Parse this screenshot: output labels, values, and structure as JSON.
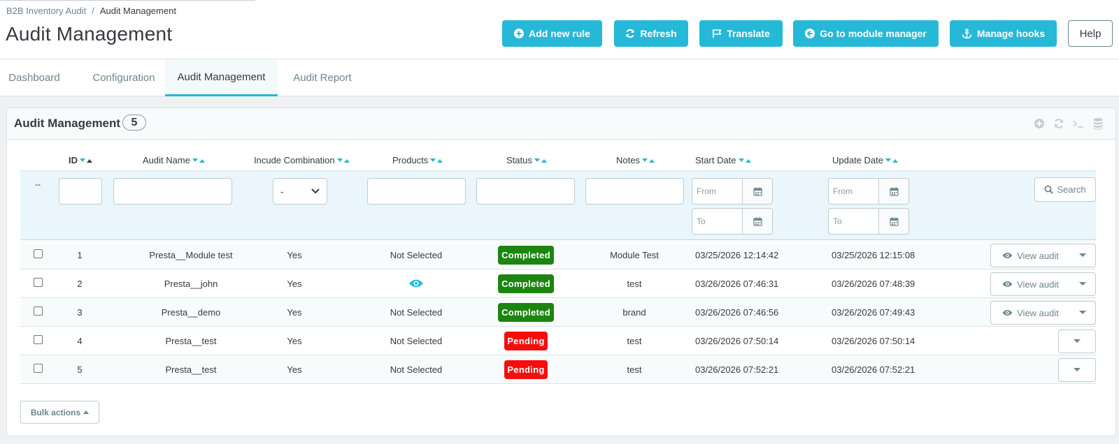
{
  "breadcrumb": {
    "parent": "B2B Inventory Audit",
    "separator": "/",
    "current": "Audit Management"
  },
  "page_title": "Audit Management",
  "toolbar": {
    "add_rule": "Add new rule",
    "refresh": "Refresh",
    "translate": "Translate",
    "module_manager": "Go to module manager",
    "manage_hooks": "Manage hooks",
    "help": "Help"
  },
  "tabs": [
    {
      "label": "Dashboard"
    },
    {
      "label": "Configuration"
    },
    {
      "label": "Audit Management",
      "active": true
    },
    {
      "label": "Audit Report"
    }
  ],
  "panel": {
    "title": "Audit Management",
    "count": "5"
  },
  "columns": {
    "id": "ID",
    "name": "Audit Name",
    "combination": "Incude Combination",
    "products": "Products",
    "status": "Status",
    "notes": "Notes",
    "start_date": "Start Date",
    "update_date": "Update Date"
  },
  "filters": {
    "dash": "--",
    "select_value": "-",
    "from_placeholder": "From",
    "to_placeholder": "To",
    "search_label": "Search"
  },
  "rows": [
    {
      "id": "1",
      "name": "Presta__Module test",
      "combination": "Yes",
      "products": "Not Selected",
      "status": "Completed",
      "notes": "Module Test",
      "start": "03/25/2026 12:14:42",
      "updated": "03/25/2026 12:15:08",
      "action": "View audit"
    },
    {
      "id": "2",
      "name": "Presta__john",
      "combination": "Yes",
      "products": "",
      "status": "Completed",
      "notes": "test",
      "start": "03/26/2026 07:46:31",
      "updated": "03/26/2026 07:48:39",
      "action": "View audit"
    },
    {
      "id": "3",
      "name": "Presta__demo",
      "combination": "Yes",
      "products": "Not Selected",
      "status": "Completed",
      "notes": "brand",
      "start": "03/26/2026 07:46:56",
      "updated": "03/26/2026 07:49:43",
      "action": "View audit"
    },
    {
      "id": "4",
      "name": "Presta__test",
      "combination": "Yes",
      "products": "Not Selected",
      "status": "Pending",
      "notes": "test",
      "start": "03/26/2026 07:50:14",
      "updated": "03/26/2026 07:50:14",
      "action": ""
    },
    {
      "id": "5",
      "name": "Presta__test",
      "combination": "Yes",
      "products": "Not Selected",
      "status": "Pending",
      "notes": "test",
      "start": "03/26/2026 07:52:21",
      "updated": "03/26/2026 07:52:21",
      "action": ""
    }
  ],
  "bulk_actions": "Bulk actions",
  "colors": {
    "accent": "#25b9d7",
    "completed": "#1b8510",
    "pending": "#f50e0e",
    "text": "#363a41",
    "muted": "#6c868e"
  }
}
